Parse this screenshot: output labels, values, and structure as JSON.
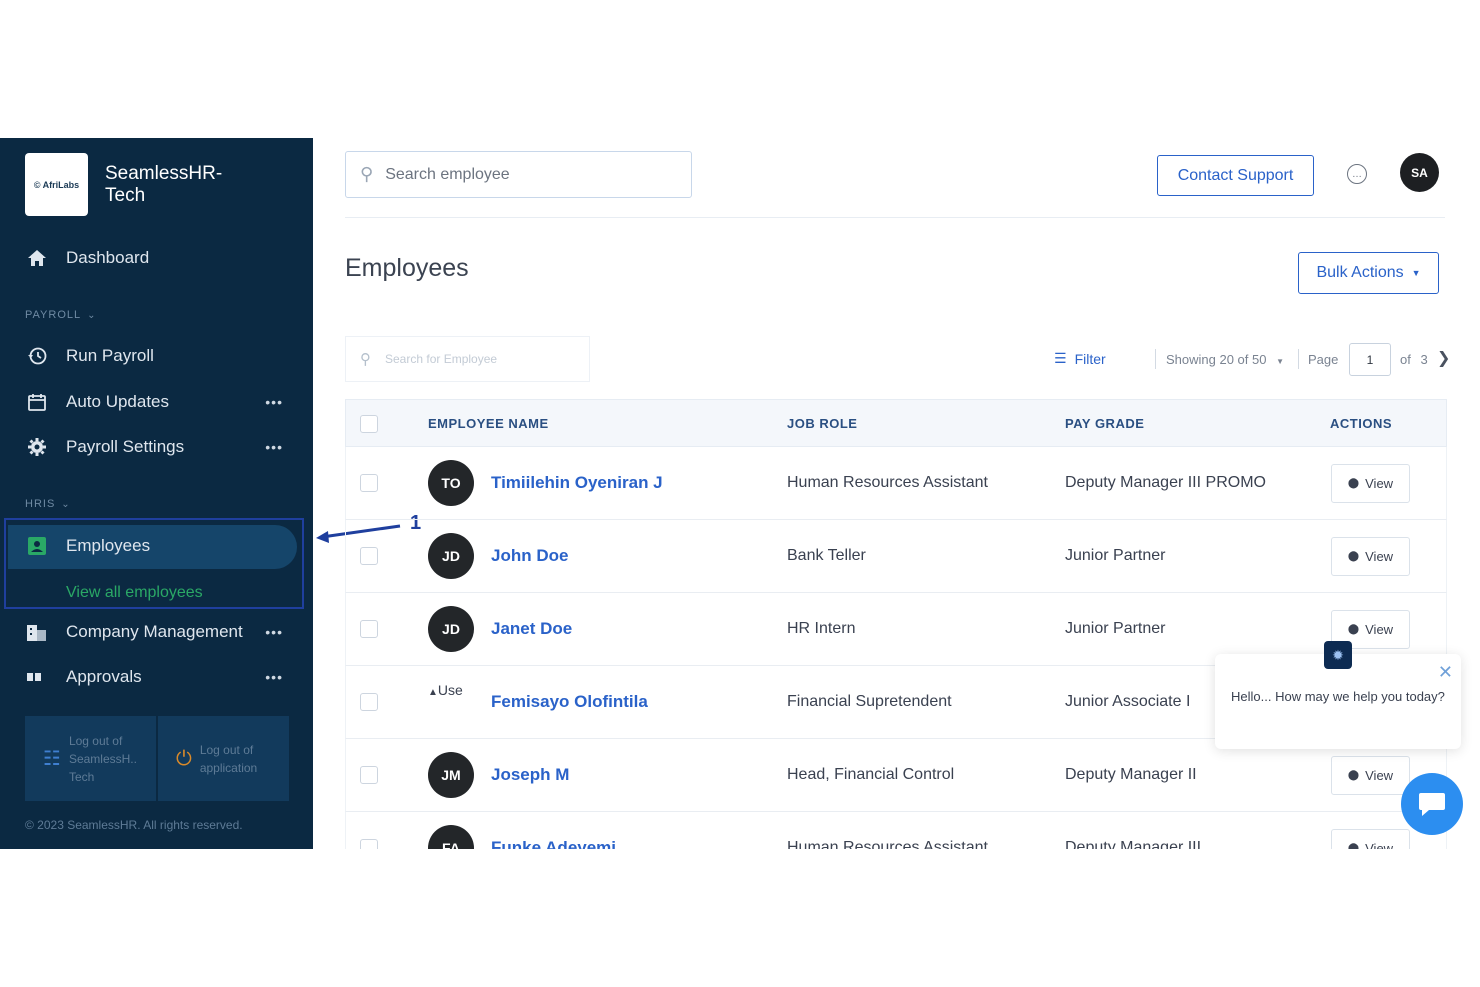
{
  "brand": {
    "logo_text": "© AfriLabs",
    "name": "SeamlessHR- Tech"
  },
  "sidebar": {
    "dashboard": "Dashboard",
    "payroll_section": "PAYROLL",
    "run_payroll": "Run Payroll",
    "auto_updates": "Auto Updates",
    "payroll_settings": "Payroll Settings",
    "hris_section": "HRIS",
    "employees": "Employees",
    "view_all_employees": "View all employees",
    "company_management": "Company Management",
    "approvals": "Approvals",
    "more": "•••",
    "logout_company": "Log out of SeamlessH.. Tech",
    "logout_app": "Log out of application",
    "copyright": "© 2023 SeamlessHR. All rights reserved."
  },
  "annotation": {
    "number": "1"
  },
  "header": {
    "search_placeholder": "Search employee",
    "contact_support": "Contact Support",
    "avatar_initials": "SA"
  },
  "page": {
    "title": "Employees",
    "bulk_actions": "Bulk Actions"
  },
  "toolbar": {
    "search_placeholder": "Search for Employee",
    "filter": "Filter",
    "showing": "Showing 20 of 50",
    "page_label": "Page",
    "page_value": "1",
    "of_label": "of",
    "total_pages": "3"
  },
  "table": {
    "headers": {
      "name": "EMPLOYEE NAME",
      "role": "JOB ROLE",
      "grade": "PAY GRADE",
      "actions": "ACTIONS"
    },
    "view_label": "View",
    "broken_img_alt": "Use",
    "rows": [
      {
        "initials": "TO",
        "name": "Timiilehin Oyeniran J",
        "role": "Human Resources Assistant",
        "grade": "Deputy Manager III PROMO"
      },
      {
        "initials": "JD",
        "name": "John Doe",
        "role": "Bank Teller",
        "grade": "Junior Partner"
      },
      {
        "initials": "JD",
        "name": "Janet Doe",
        "role": "HR Intern",
        "grade": "Junior Partner"
      },
      {
        "initials": "",
        "name": "Femisayo Olofintila",
        "role": "Financial Supretendent",
        "grade": "Junior Associate I"
      },
      {
        "initials": "JM",
        "name": "Joseph M",
        "role": "Head, Financial Control",
        "grade": "Deputy Manager II"
      },
      {
        "initials": "FA",
        "name": "Funke Adeyemi",
        "role": "Human Resources Assistant",
        "grade": "Deputy Manager III"
      }
    ]
  },
  "chat": {
    "message": "Hello... How may we help you today?"
  },
  "colors": {
    "sidebar_bg": "#0b2942",
    "accent": "#2a62c9",
    "active_green": "#2aa866"
  }
}
